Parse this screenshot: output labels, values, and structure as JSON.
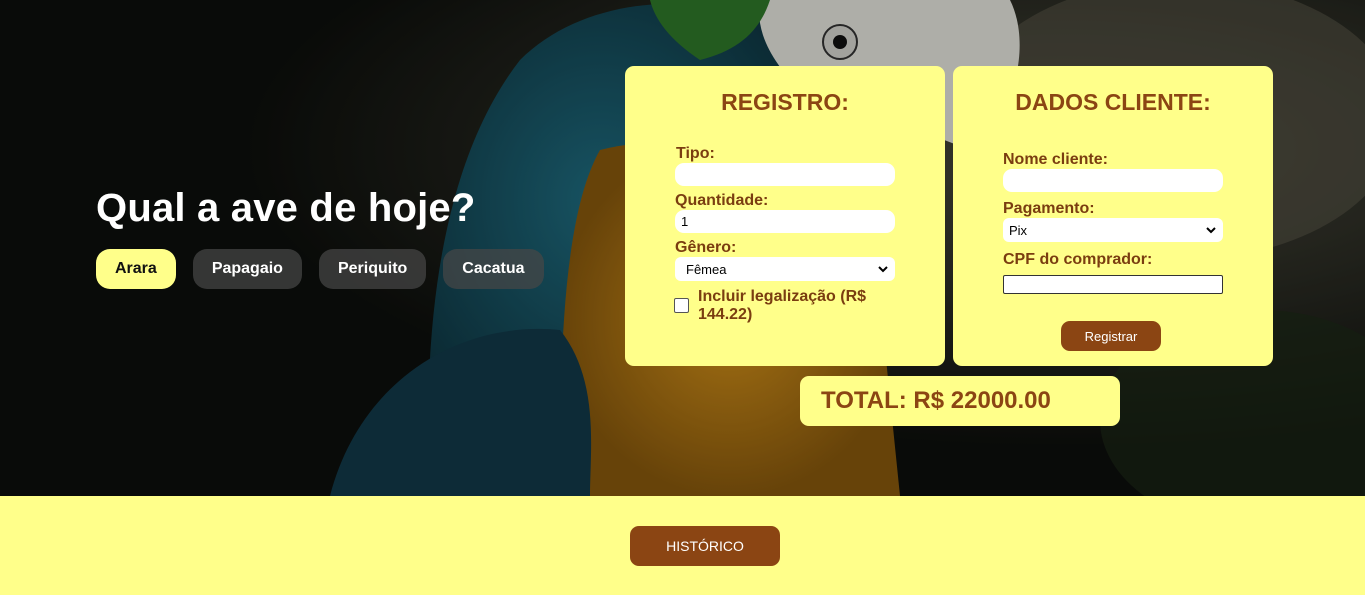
{
  "hero": {
    "headline": "Qual a ave de hoje?",
    "bird_tabs": [
      {
        "label": "Arara",
        "active": true
      },
      {
        "label": "Papagaio",
        "active": false
      },
      {
        "label": "Periquito",
        "active": false
      },
      {
        "label": "Cacatua",
        "active": false
      }
    ]
  },
  "registro": {
    "title": "REGISTRO:",
    "tipo_label": "Tipo:",
    "tipo_value": "",
    "quantidade_label": "Quantidade:",
    "quantidade_value": "1",
    "genero_label": "Gênero:",
    "genero_value": "Fêmea",
    "legalizacao_label": "Incluir legalização (R$ 144.22)",
    "legalizacao_checked": false
  },
  "cliente": {
    "title": "DADOS CLIENTE:",
    "nome_label": "Nome cliente:",
    "nome_value": "",
    "pagamento_label": "Pagamento:",
    "pagamento_value": "Pix",
    "cpf_label": "CPF do comprador:",
    "cpf_value": "",
    "registrar_label": "Registrar"
  },
  "total": "TOTAL: R$ 22000.00",
  "footer": {
    "historico_label": "HISTÓRICO"
  },
  "colors": {
    "accent_yellow": "#ffff8a",
    "brown": "#8b4513"
  }
}
